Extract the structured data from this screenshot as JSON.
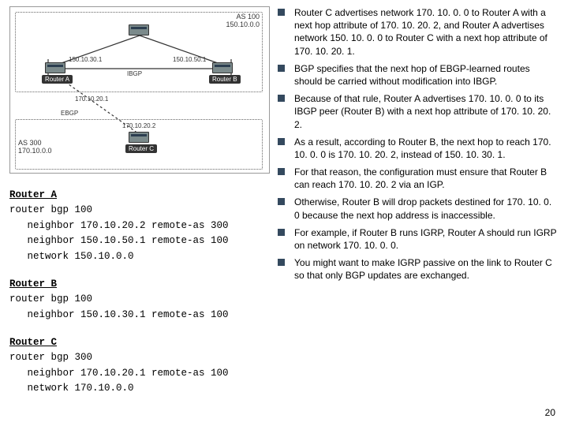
{
  "diagram": {
    "as100": {
      "label": "AS 100",
      "net": "150.10.0.0"
    },
    "as300": {
      "label": "AS 300",
      "net": "170.10.0.0"
    },
    "routerA": {
      "name": "Router A",
      "if_right": "150.10.30.1",
      "if_down": "170.10.20.1"
    },
    "routerB": {
      "name": "Router B",
      "if_left": "150.10.50.1"
    },
    "routerC": {
      "name": "Router C",
      "if_up": "170.10.20.2"
    },
    "link_ab": "IBGP",
    "link_ac": "EBGP",
    "router_top_icon": "router-icon"
  },
  "configs": {
    "a": {
      "title": "Router A",
      "lines": [
        "router bgp 100",
        "   neighbor 170.10.20.2 remote-as 300",
        "   neighbor 150.10.50.1 remote-as 100",
        "   network 150.10.0.0"
      ]
    },
    "b": {
      "title": "Router B",
      "lines": [
        "router bgp 100",
        "   neighbor 150.10.30.1 remote-as 100"
      ]
    },
    "c": {
      "title": "Router C",
      "lines": [
        "router bgp 300",
        "   neighbor 170.10.20.1 remote-as 100",
        "   network 170.10.0.0"
      ]
    }
  },
  "bullets": [
    "Router C advertises network 170. 10. 0. 0 to Router A with a next hop attribute of 170. 10. 20. 2, and Router A advertises network 150. 10. 0. 0 to Router C with a next hop attribute of 170. 10. 20. 1.",
    "BGP specifies that the next hop of EBGP-learned routes should be carried without modification into IBGP.",
    "Because of that rule, Router A advertises 170. 10. 0. 0 to its IBGP peer (Router B) with a next hop attribute of 170. 10. 20. 2.",
    "As a result, according to Router B, the next hop to reach 170. 10. 0. 0 is 170. 10. 20. 2, instead of 150. 10. 30. 1.",
    "For that reason, the configuration must ensure that Router B can reach 170. 10. 20. 2 via an IGP.",
    "Otherwise, Router B will drop packets destined for 170. 10. 0. 0 because the next hop address is inaccessible.",
    "For example, if Router B runs IGRP, Router A should run IGRP on network 170. 10. 0. 0.",
    "You might want to make IGRP passive on the link to Router C so that only BGP updates are exchanged."
  ],
  "slide_number": "20"
}
